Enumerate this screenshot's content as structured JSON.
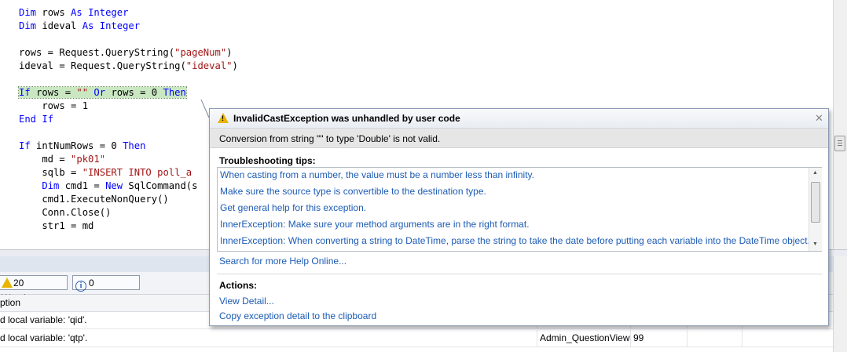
{
  "editor": {
    "lines": {
      "l1": {
        "kw1": "Dim",
        "mid": " rows ",
        "kw2": "As",
        "sp": " ",
        "kw3": "Integer"
      },
      "l2": {
        "kw1": "Dim",
        "mid": " ideval ",
        "kw2": "As",
        "sp": " ",
        "kw3": "Integer"
      },
      "l4": {
        "pre": "rows = Request.QueryString(",
        "str": "\"pageNum\"",
        "post": ")"
      },
      "l5": {
        "pre": "ideval = Request.QueryString(",
        "str": "\"ideval\"",
        "post": ")"
      },
      "l7": {
        "kw1": "If",
        "a": " rows = ",
        "str": "\"\"",
        "sp1": " ",
        "kw2": "Or",
        "b": " rows = 0 ",
        "kw3": "Then"
      },
      "l8": {
        "text": "    rows = 1"
      },
      "l9": {
        "kw1": "End",
        "sp": " ",
        "kw2": "If"
      },
      "l11": {
        "kw1": "If",
        "mid": " intNumRows = 0 ",
        "kw2": "Then"
      },
      "l12": {
        "pre": "    md = ",
        "str": "\"pk01\""
      },
      "l13": {
        "pre": "    sqlb = ",
        "str": "\"INSERT INTO poll_a"
      },
      "l14": {
        "ind": "    ",
        "kw1": "Dim",
        "mid": " cmd1 = ",
        "kw2": "New",
        "post": " SqlCommand(s"
      },
      "l15": {
        "text": "    cmd1.ExecuteNonQuery()"
      },
      "l16": {
        "text": "    Conn.Close()"
      },
      "l17": {
        "text": "    str1 = md"
      }
    }
  },
  "error_list": {
    "warnings_label": "20 Warnings",
    "messages_label": "0 Messages",
    "info_glyph": "i",
    "header_description": "ption",
    "rows": [
      {
        "description": "d local variable: 'qid'.",
        "file": "",
        "line": ""
      },
      {
        "description": "d local variable: 'qtp'.",
        "file": "Admin_QuestionView.",
        "line": "99"
      }
    ]
  },
  "exception_popup": {
    "title": "InvalidCastException was unhandled by user code",
    "message": "Conversion from string \"\" to type 'Double' is not valid.",
    "tips_label": "Troubleshooting tips:",
    "tips": [
      "When casting from a number, the value must be a number less than infinity.",
      "Make sure the source type is convertible to the destination type.",
      "Get general help for this exception.",
      "InnerException: Make sure your method arguments are in the right format.",
      "InnerException: When converting a string to DateTime, parse the string to take the date before putting each variable into the DateTime object."
    ],
    "search_link": "Search for more Help Online...",
    "actions_label": "Actions:",
    "view_detail": "View Detail...",
    "copy_detail": "Copy exception detail to the clipboard",
    "close_glyph": "✕",
    "warn_glyph": "!"
  },
  "colors": {
    "keyword": "#0000ff",
    "string": "#a31515",
    "link": "#1c5bb4",
    "highlight": "#c9e8c2"
  }
}
